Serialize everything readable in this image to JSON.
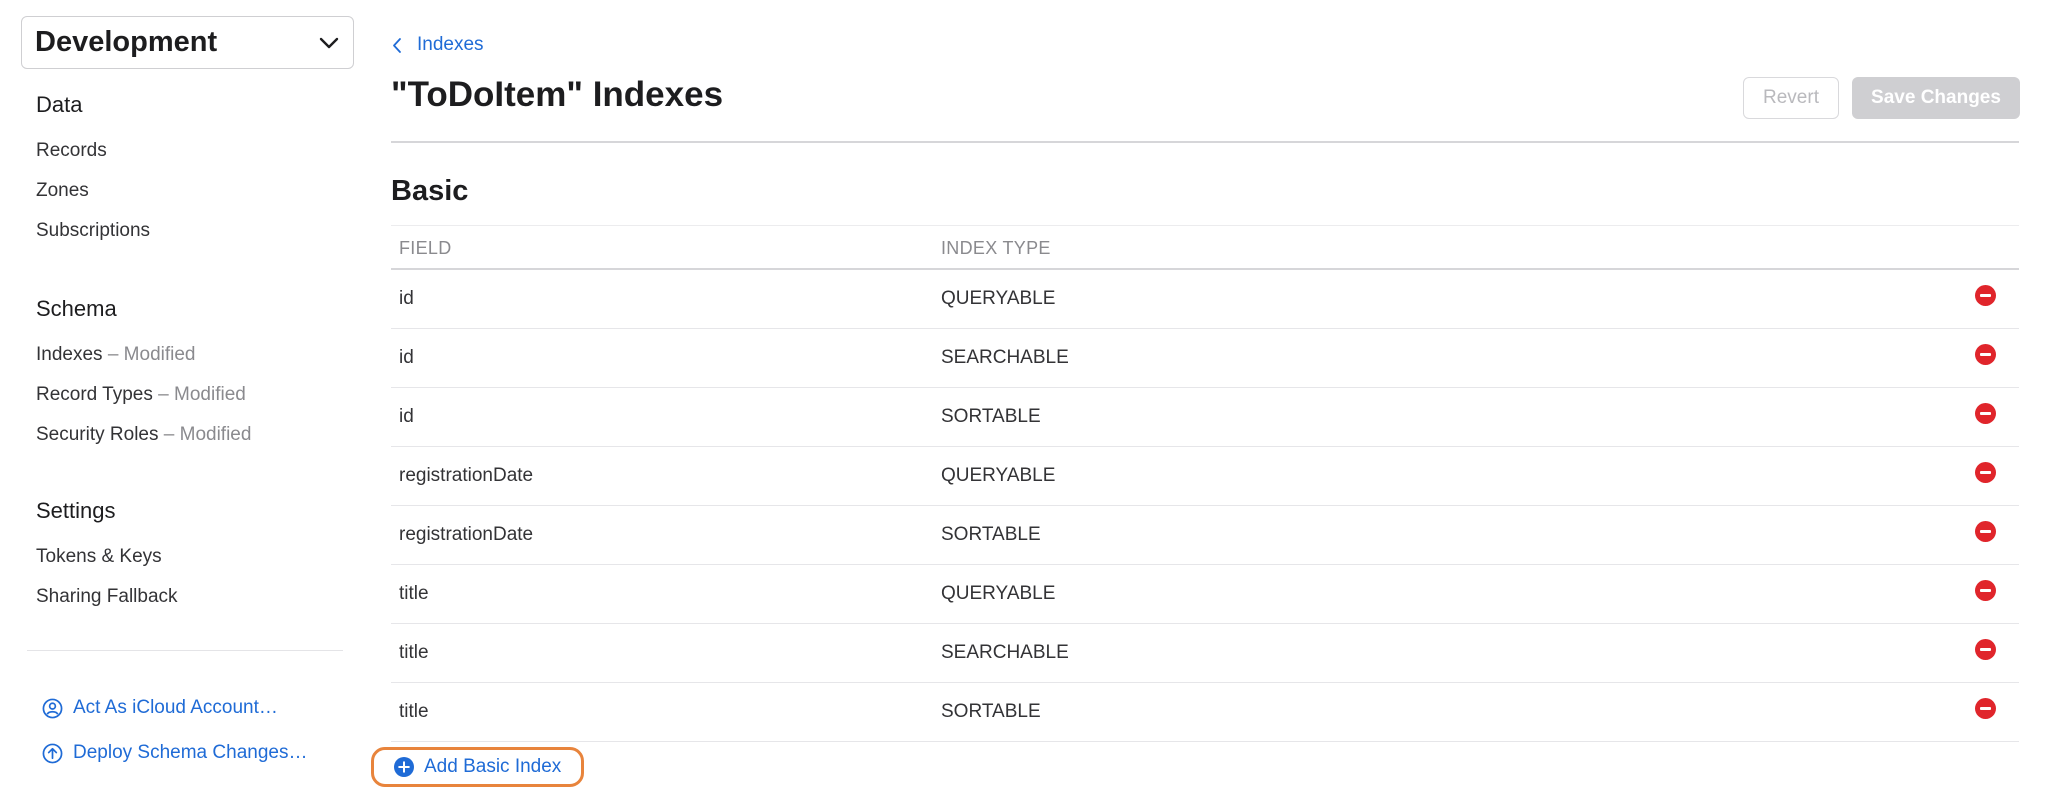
{
  "sidebar": {
    "environment": "Development",
    "groups": [
      {
        "heading": "Data",
        "items": [
          {
            "label": "Records",
            "status": ""
          },
          {
            "label": "Zones",
            "status": ""
          },
          {
            "label": "Subscriptions",
            "status": ""
          }
        ]
      },
      {
        "heading": "Schema",
        "items": [
          {
            "label": "Indexes",
            "status": " – Modified"
          },
          {
            "label": "Record Types",
            "status": " – Modified"
          },
          {
            "label": "Security Roles",
            "status": " – Modified"
          }
        ]
      },
      {
        "heading": "Settings",
        "items": [
          {
            "label": "Tokens & Keys",
            "status": ""
          },
          {
            "label": "Sharing Fallback",
            "status": ""
          }
        ]
      }
    ],
    "actions": {
      "act_as": "Act As iCloud Account…",
      "deploy": "Deploy Schema Changes…"
    }
  },
  "main": {
    "back_label": "Indexes",
    "title": "\"ToDoItem\" Indexes",
    "revert_label": "Revert",
    "save_label": "Save Changes",
    "section_title": "Basic",
    "columns": {
      "field": "FIELD",
      "index_type": "INDEX TYPE"
    },
    "rows": [
      {
        "field": "id",
        "index_type": "QUERYABLE"
      },
      {
        "field": "id",
        "index_type": "SEARCHABLE"
      },
      {
        "field": "id",
        "index_type": "SORTABLE"
      },
      {
        "field": "registrationDate",
        "index_type": "QUERYABLE"
      },
      {
        "field": "registrationDate",
        "index_type": "SORTABLE"
      },
      {
        "field": "title",
        "index_type": "QUERYABLE"
      },
      {
        "field": "title",
        "index_type": "SEARCHABLE"
      },
      {
        "field": "title",
        "index_type": "SORTABLE"
      }
    ],
    "add_label": "Add Basic Index"
  },
  "colors": {
    "accent": "#1f6bd6",
    "remove": "#e0252b",
    "highlight": "#e8843c"
  },
  "icons": {
    "environment_dropdown": "chevron-down-icon",
    "back": "chevron-left-icon",
    "act_as": "person-circle-icon",
    "deploy": "arrow-up-circle-icon",
    "remove": "minus-circle-icon",
    "add": "plus-circle-icon"
  }
}
